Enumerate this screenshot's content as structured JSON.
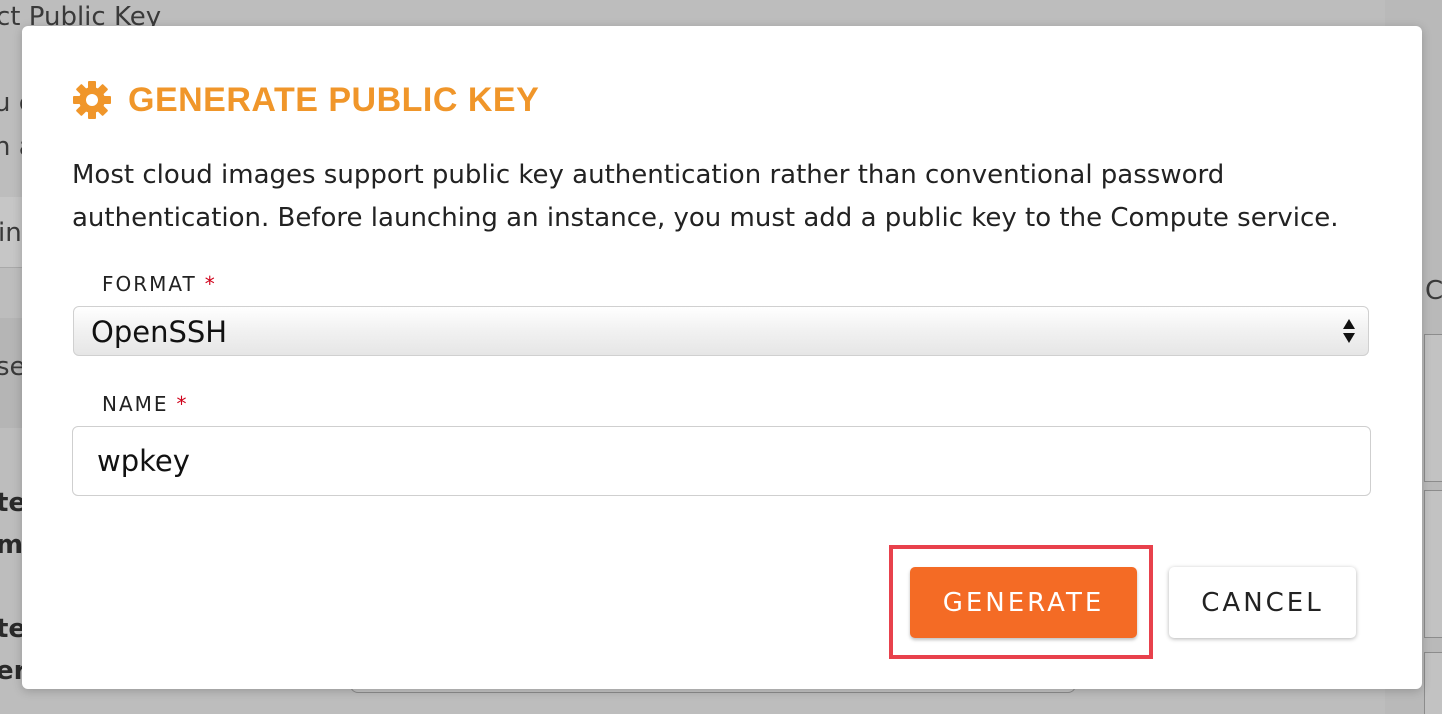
{
  "background": {
    "heading_fragment": "ct Public Key",
    "line_fragments": [
      "u c",
      "n a",
      "in",
      "se"
    ],
    "bold_fragments": [
      "te",
      "m",
      "te",
      "er"
    ],
    "right_fragment": "C"
  },
  "modal": {
    "icon": "gear-icon",
    "title": "GENERATE PUBLIC KEY",
    "description": "Most cloud images support public key authentication rather than conventional password authentication. Before launching an instance, you must add a public key to the Compute service.",
    "accent_color": "#f0962a",
    "format": {
      "label": "FORMAT",
      "required_marker": "*",
      "selected_value": "OpenSSH"
    },
    "name": {
      "label": "NAME",
      "required_marker": "*",
      "value": "wpkey"
    },
    "buttons": {
      "generate_label": "GENERATE",
      "cancel_label": "CANCEL",
      "generate_color": "#f46b25"
    },
    "highlight_color": "#e8414c"
  }
}
